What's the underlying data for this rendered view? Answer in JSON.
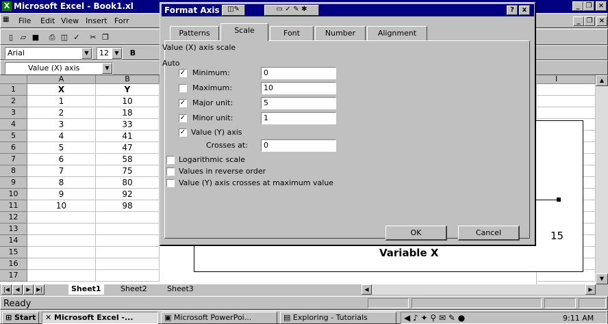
{
  "excel": {
    "title": "Microsoft Excel - Book1.xl",
    "menus": [
      "File",
      "Edit",
      "View",
      "Insert",
      "Forr"
    ],
    "font_name": "Arial",
    "font_size": "12",
    "bold_label": "B",
    "name_box": "Value (X) axis",
    "columns": [
      "A",
      "B"
    ],
    "column_i": "I",
    "rows": [
      "1",
      "2",
      "3",
      "4",
      "5",
      "6",
      "7",
      "8",
      "9",
      "10",
      "11",
      "12",
      "13",
      "14",
      "15",
      "16",
      "17"
    ],
    "table": [
      [
        "X",
        "Y"
      ],
      [
        "1",
        "10"
      ],
      [
        "2",
        "18"
      ],
      [
        "3",
        "33"
      ],
      [
        "4",
        "41"
      ],
      [
        "5",
        "47"
      ],
      [
        "6",
        "58"
      ],
      [
        "7",
        "75"
      ],
      [
        "8",
        "80"
      ],
      [
        "9",
        "92"
      ],
      [
        "10",
        "98"
      ]
    ]
  },
  "chart": {
    "x_axis_label": "Variable X",
    "tick_label": "15"
  },
  "dialog": {
    "title": "Format Axis",
    "help_btn": "?",
    "close_btn": "x",
    "tabs": [
      "Patterns",
      "Scale",
      "Font",
      "Number",
      "Alignment"
    ],
    "active_tab": "Scale",
    "section_title": "Value (X) axis scale",
    "auto_label": "Auto",
    "minimum": {
      "label": "Minimum:",
      "checked": true,
      "value": "0"
    },
    "maximum": {
      "label": "Maximum:",
      "checked": false,
      "value": "10"
    },
    "major_unit": {
      "label": "Major unit:",
      "checked": true,
      "value": "5"
    },
    "minor_unit": {
      "label": "Minor unit:",
      "checked": true,
      "value": "1"
    },
    "value_y_axis": {
      "label": "Value (Y) axis",
      "checked": true
    },
    "crosses_at": {
      "label": "Crosses at:",
      "value": "0"
    },
    "log_scale": {
      "label": "Logarithmic scale",
      "checked": false
    },
    "reverse_order": {
      "label": "Values in reverse order",
      "checked": false
    },
    "crosses_max": {
      "label": "Value (Y) axis crosses at maximum value",
      "checked": false
    },
    "ok_label": "OK",
    "cancel_label": "Cancel"
  },
  "sheets": [
    "Sheet1",
    "Sheet2",
    "Sheet3"
  ],
  "status": "Ready",
  "taskbar": {
    "start": "Start",
    "tasks": [
      "Microsoft Excel -...",
      "Microsoft PowerPoi...",
      "Exploring - Tutorials"
    ],
    "clock": "9:11 AM"
  }
}
